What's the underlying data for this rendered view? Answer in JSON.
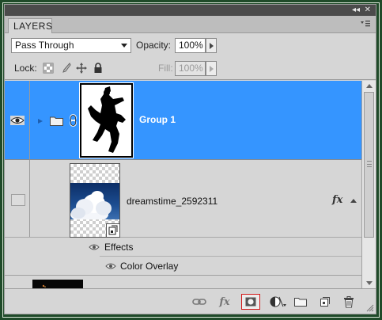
{
  "panel": {
    "title": "LAYERS",
    "collapse_glyph": "◂◂",
    "close_glyph": "✕"
  },
  "blend_mode": {
    "value": "Pass Through",
    "opacity_label": "Opacity:",
    "opacity_value": "100%"
  },
  "lock_row": {
    "lock_label": "Lock:",
    "fill_label": "Fill:",
    "fill_value": "100%"
  },
  "layers": [
    {
      "name": "Group 1",
      "kind": "group",
      "visible": true,
      "selected": true,
      "linked": true
    },
    {
      "name": "dreamstime_2592311",
      "kind": "smart-object",
      "visible": false,
      "has_effects": true,
      "fx_label": "fx"
    }
  ],
  "effects": {
    "header": "Effects",
    "items": [
      "Color Overlay"
    ]
  },
  "footer": {
    "buttons": [
      "link-layers",
      "add-layer-style",
      "add-layer-mask",
      "new-adjustment-layer",
      "new-group",
      "new-layer",
      "delete-layer"
    ],
    "active": "add-layer-mask",
    "fx_label": "fx"
  },
  "colors": {
    "selection": "#3595ff",
    "panel_bg": "#d6d6d6",
    "frame": "#1f4a29",
    "active_button_border": "#d21a1a"
  }
}
